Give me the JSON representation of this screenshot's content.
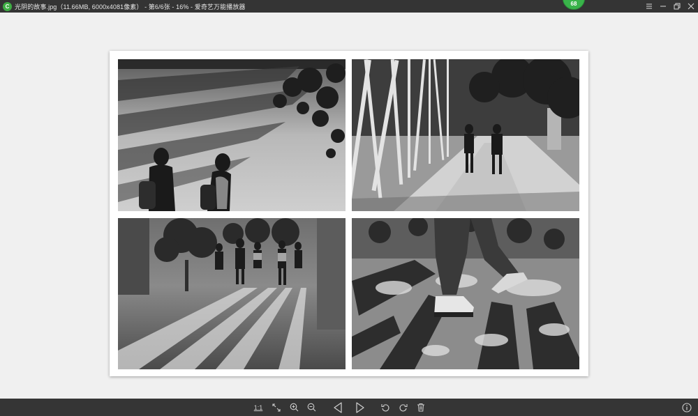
{
  "window": {
    "logo_text": "C",
    "title": "光阴的故事.jpg（11.66MB, 6000x4081像素） - 第6/6张 - 16% - 爱奇艺万能播放器",
    "badge": "68"
  },
  "toolbar": {
    "actual_size_label": "1:1",
    "items": [
      "fit-window",
      "zoom-in",
      "zoom-out",
      "previous",
      "next",
      "rotate-left",
      "rotate-right",
      "delete",
      "info"
    ]
  },
  "image": {
    "file_name": "光阴的故事.jpg",
    "file_size": "11.66MB",
    "dimensions": "6000x4081像素",
    "position": "第6/6张",
    "zoom": "16%"
  },
  "colors": {
    "titlebar": "#343434",
    "toolbar": "#353535",
    "badge": "#39b34a",
    "canvas": "#f0f0f0"
  }
}
